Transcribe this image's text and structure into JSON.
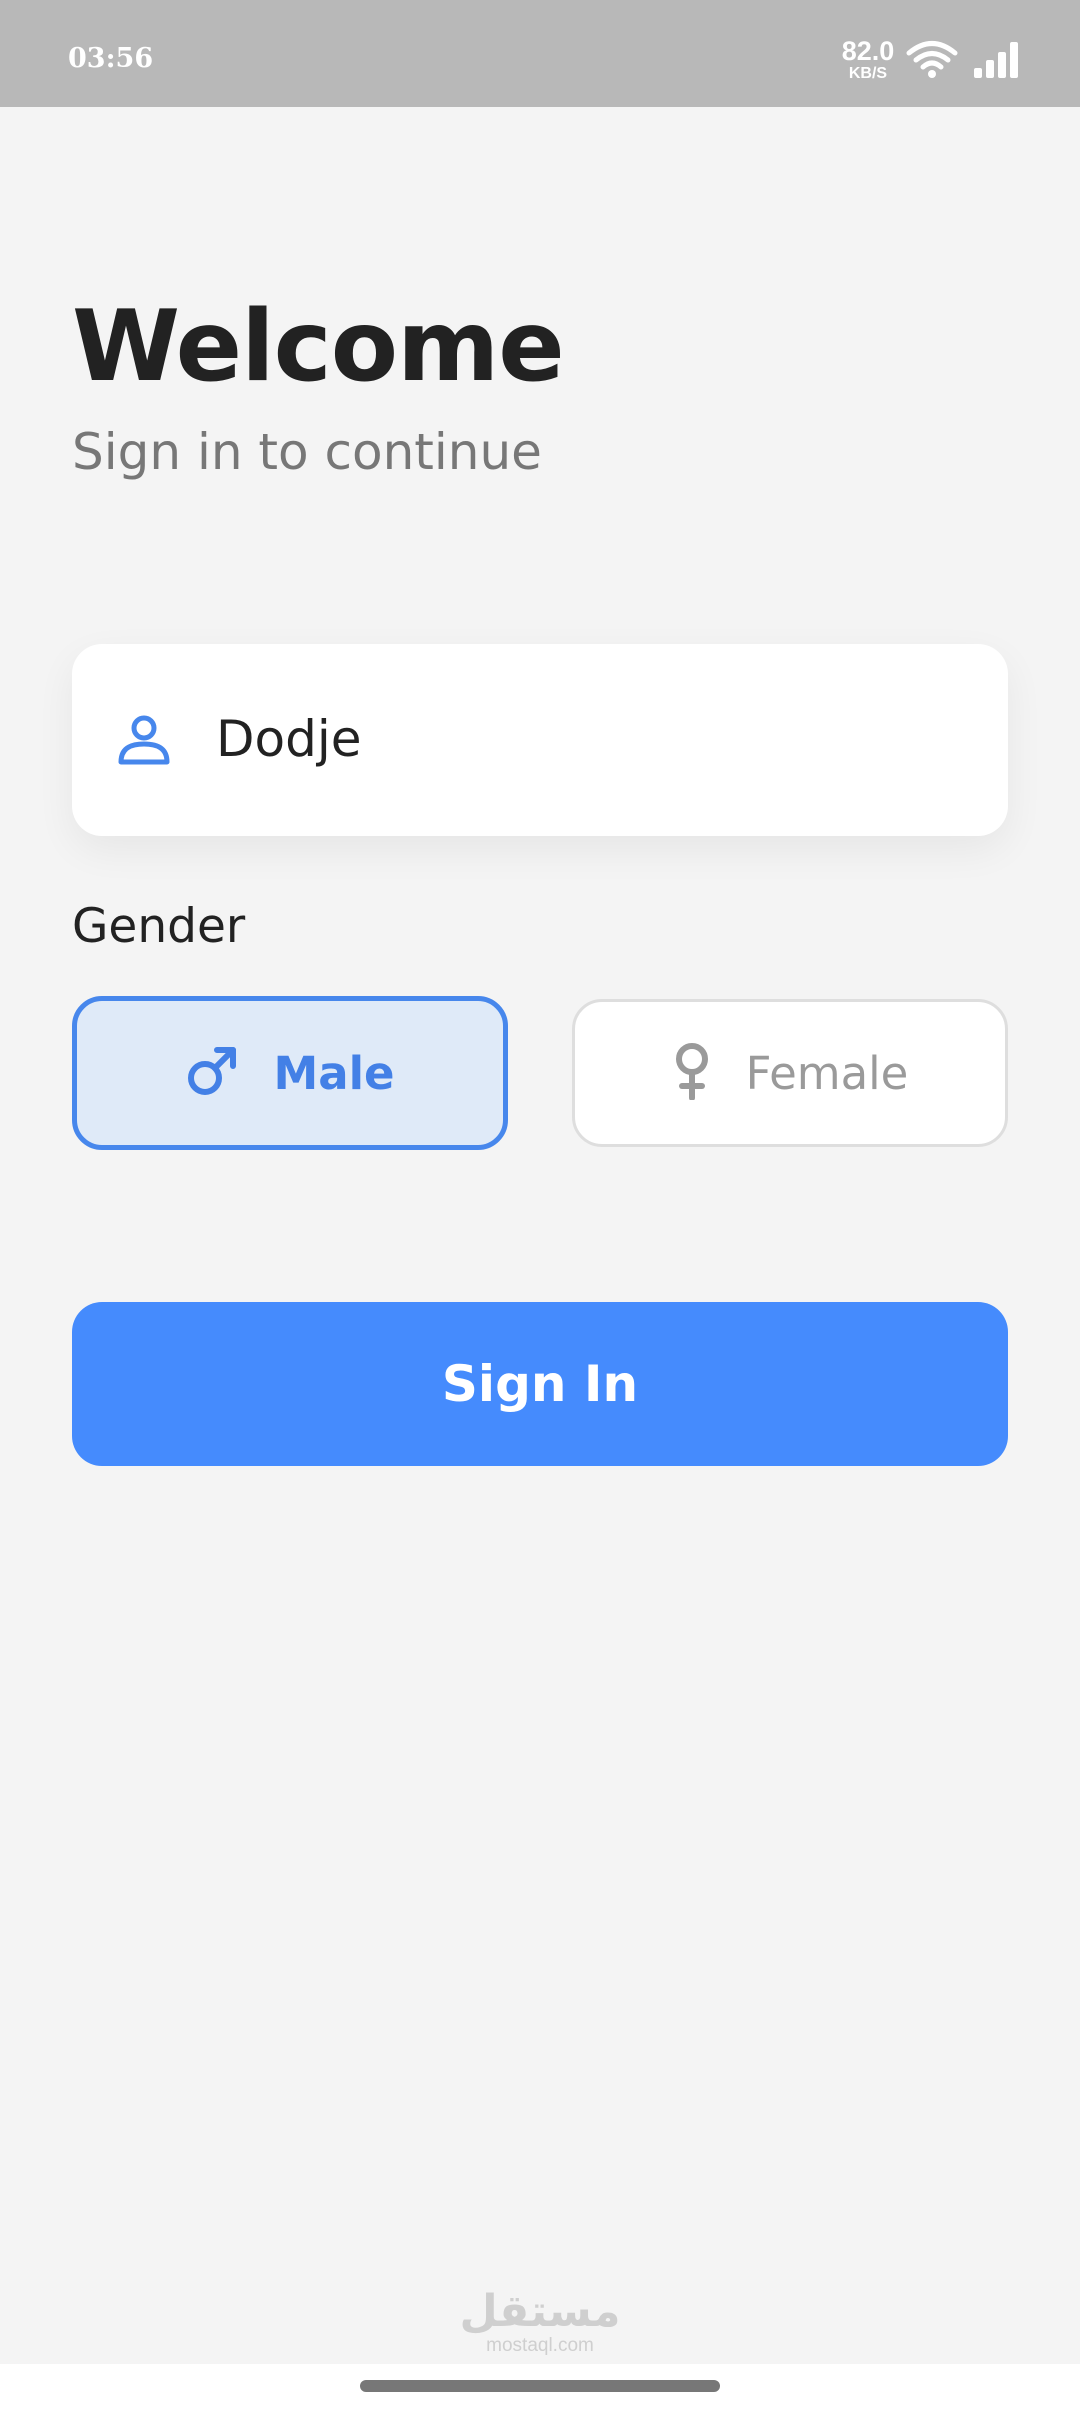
{
  "status_bar": {
    "time": "03:56",
    "net_speed_value": "82.0",
    "net_speed_unit": "KB/S",
    "wifi_icon": "wifi-icon",
    "signal_icon": "cell-signal-icon"
  },
  "header": {
    "title": "Welcome",
    "subtitle": "Sign in to continue"
  },
  "name_field": {
    "icon": "user-icon",
    "value": "Dodje"
  },
  "gender": {
    "label": "Gender",
    "selected": "Male",
    "options": [
      {
        "label": "Male",
        "icon": "male-symbol-icon",
        "selected": true
      },
      {
        "label": "Female",
        "icon": "female-symbol-icon",
        "selected": false
      }
    ]
  },
  "actions": {
    "signin_label": "Sign In"
  },
  "watermark": {
    "main": "مستقل",
    "sub": "mostaql.com"
  },
  "colors": {
    "accent": "#458bfd",
    "selected_border": "#4787ec",
    "selected_background": "#dfeaf8",
    "background": "#f4f4f4",
    "status_bar": "#b8b8b8"
  }
}
